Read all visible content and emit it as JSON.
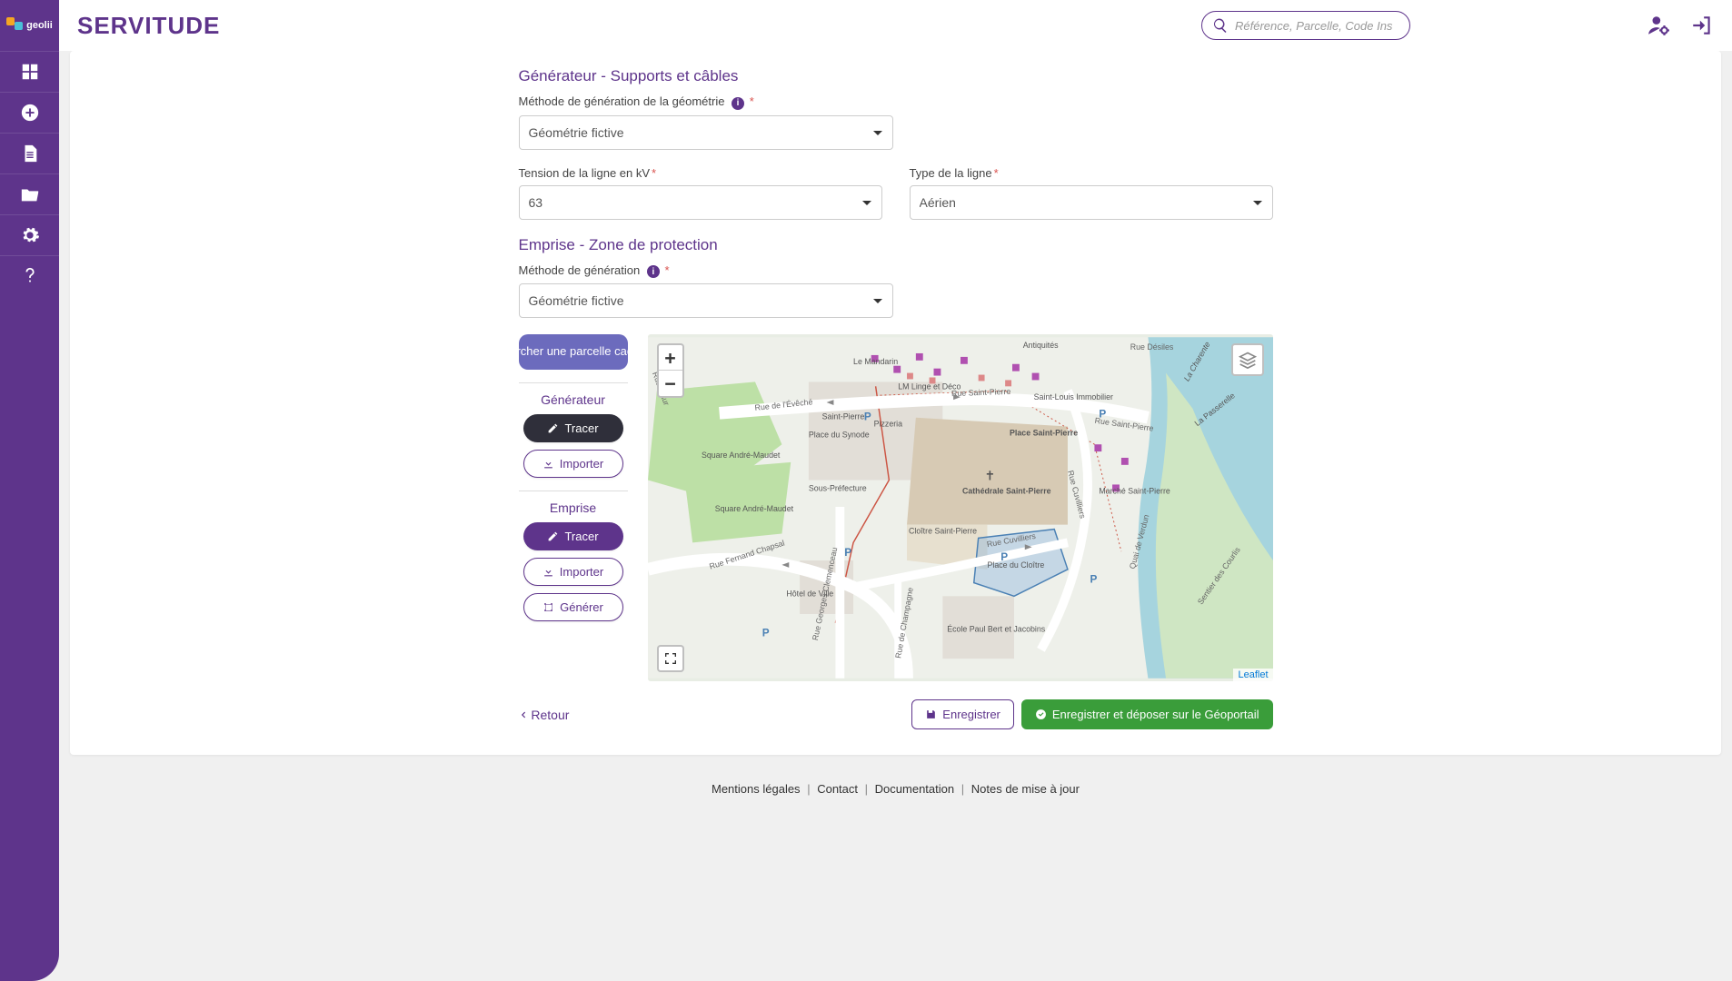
{
  "app": {
    "brand": "geolii",
    "title": "SERVITUDE"
  },
  "search": {
    "placeholder": "Référence, Parcelle, Code Ins"
  },
  "sections": {
    "generator": {
      "title": "Générateur - Supports et câbles"
    },
    "emprise": {
      "title": "Emprise - Zone de protection"
    }
  },
  "fields": {
    "geom_method": {
      "label": "Méthode de génération de la géométrie",
      "value": "Géométrie fictive"
    },
    "tension": {
      "label": "Tension de la ligne en kV",
      "value": "63"
    },
    "line_type": {
      "label": "Type de la ligne",
      "value": "Aérien"
    },
    "gen_method2": {
      "label": "Méthode de génération",
      "value": "Géométrie fictive"
    }
  },
  "tools": {
    "search_parcel": "Rechercher une parcelle cadastrale",
    "generator_label": "Générateur",
    "emprise_label": "Emprise",
    "trace": "Tracer",
    "import": "Importer",
    "generate": "Générer"
  },
  "map": {
    "zoom_in": "+",
    "zoom_out": "−",
    "attribution": "Leaflet",
    "places": {
      "cathedrale": "Cathédrale Saint-Pierre",
      "place_sp": "Place Saint-Pierre",
      "cloitre": "Cloître Saint-Pierre",
      "place_cloitre": "Place du Cloître",
      "sous_pref": "Sous-Préfecture",
      "sq_ma": "Square André-Maudet",
      "sq_ma2": "Square André-Maudet",
      "hdv": "Hôtel de Ville",
      "ecole": "École Paul Bert et Jacobins",
      "synode": "Place du Synode",
      "marche": "Marché Saint-Pierre",
      "stp_label": "Saint-Pierre",
      "pizzeria": "Pizzeria",
      "lm": "LM Linge et Déco",
      "mandarin": "Le Mandarin",
      "sli": "Saint-Louis Immobilier",
      "antiq": "Antiquités",
      "passerelle": "La Passerelle",
      "charente": "La Charente"
    },
    "streets": {
      "st_pierre": "Rue Saint-Pierre",
      "st_pierre2": "Rue Saint-Pierre",
      "eveche": "Rue de l'Évêché",
      "cuvilliers": "Rue Cuvilliers",
      "cuvilliers2": "Rue Cuvilliers",
      "clemenceau": "Rue Georges Clemenceau",
      "chapsal": "Rue Fernand Chapsal",
      "verdun": "Quai de Verdun",
      "desiles": "Rue Désiles",
      "maur": "Rue Maur",
      "champ": "Rue de Champagne",
      "courlis": "Sentier des Courlis"
    }
  },
  "actions": {
    "back": "Retour",
    "save": "Enregistrer",
    "save_deposit": "Enregistrer et déposer sur le Géoportail"
  },
  "footer": {
    "legal": "Mentions légales",
    "contact": "Contact",
    "doc": "Documentation",
    "notes": "Notes de mise à jour"
  }
}
